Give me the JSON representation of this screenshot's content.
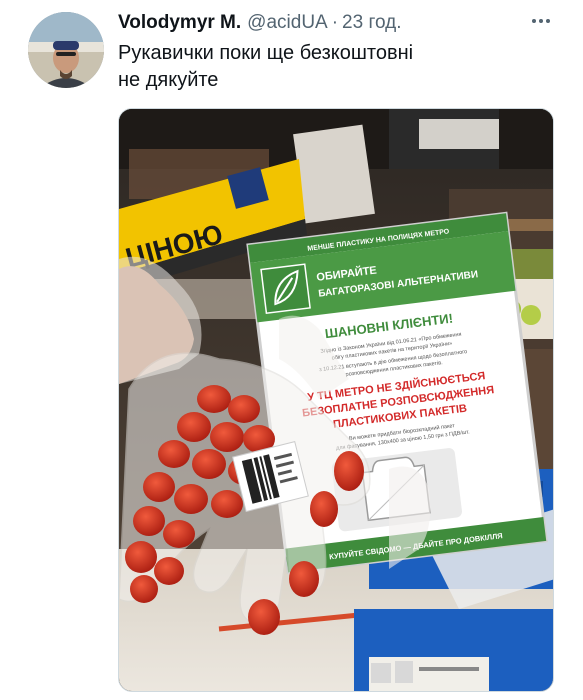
{
  "author": {
    "display_name": "Volodymyr M.",
    "handle": "@acidUA",
    "separator": "·",
    "time": "23 год."
  },
  "tweet": {
    "lines": [
      "Рукавички поки ще безкоштовні",
      "не дякуйте"
    ]
  },
  "media": {
    "store_sign_fragment": "ЦІНОЮ",
    "poster": {
      "top_banner": "МЕНШЕ ПЛАСТИКУ НА ПОЛИЦЯХ МЕТРО",
      "choose_line1": "ОБИРАЙТЕ",
      "choose_line2": "БАГАТОРАЗОВІ АЛЬТЕРНАТИВИ",
      "greeting": "ШАНОВНІ КЛІЄНТИ!",
      "small_text_1": "Згідно із Законом України від 01.06.21 «Про обмеження",
      "small_text_2": "обігу пластикових пакетів на території України»",
      "small_text_3": "з 10.12.21 вступають в дію обмеження щодо безоплатного",
      "small_text_4": "розповсюдження пластикових пакетів.",
      "red_line1": "У ТЦ МЕТРО НЕ ЗДІЙСНЮЄТЬСЯ",
      "red_line2": "БЕЗОПЛАТНЕ РОЗПОВСЮДЖЕННЯ",
      "red_line3": "ПЛАСТИКОВИХ ПАКЕТІВ",
      "small_text_5": "Ви можете придбати біорозкладний пакет",
      "small_text_6": "для фасування, 130х400 за ціною 1,50 грн з ПДВ/шт.",
      "bottom_banner": "КУПУЙТЕ СВІДОМО — ДБАЙТЕ ПРО ДОВКІЛЛЯ"
    }
  },
  "colors": {
    "text_primary": "#0f1419",
    "text_secondary": "#536471",
    "poster_green": "#3f8c3c",
    "poster_red": "#d32a2a",
    "sign_yellow": "#f2c300",
    "tomato": "#c8261a",
    "crate_blue": "#1c5fbf"
  },
  "icons": {
    "more": "more-dots-icon",
    "leaf": "leaf-icon"
  }
}
